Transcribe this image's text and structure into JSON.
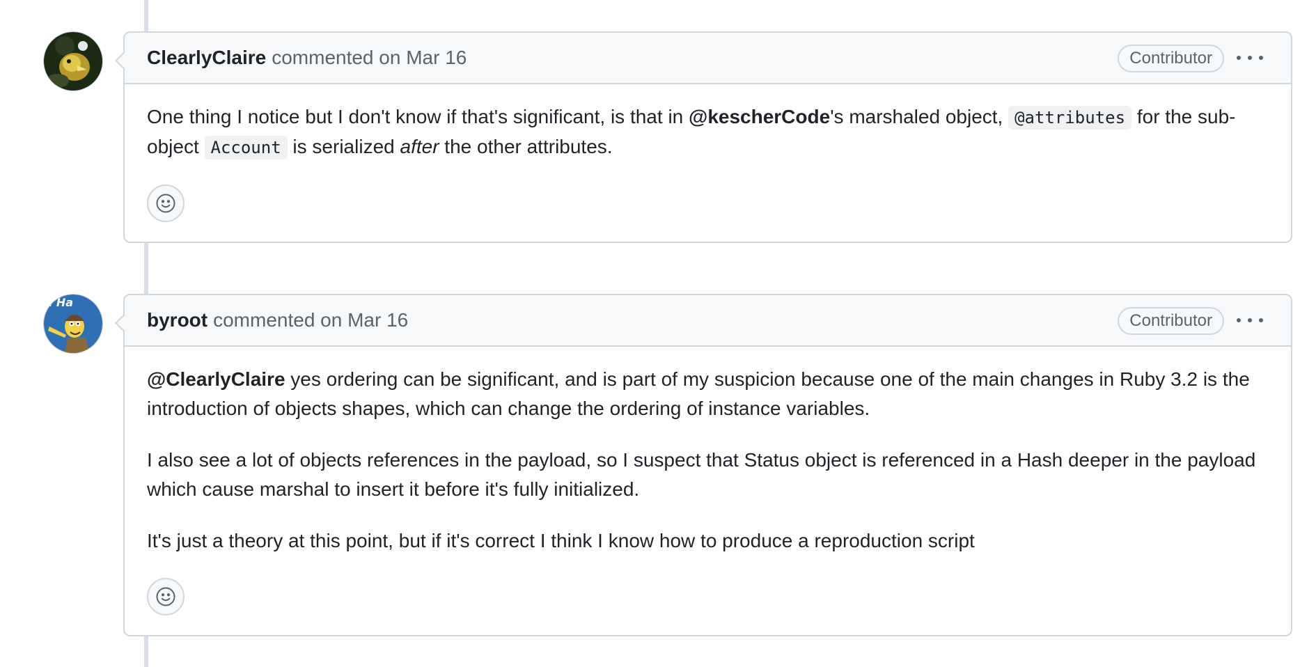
{
  "comments": [
    {
      "author": "ClearlyClaire",
      "action": "commented on",
      "date": "Mar 16",
      "role_badge": "Contributor",
      "paragraphs": [
        {
          "t1": "One thing I notice but I don't know if that's significant, is that in ",
          "mention": "@kescherCode",
          "t2": "'s marshaled object, ",
          "code1": "@attributes",
          "t3": " for the sub-object ",
          "code2": "Account",
          "t4": " is serialized ",
          "em": "after",
          "t5": " the other attributes."
        }
      ]
    },
    {
      "author": "byroot",
      "action": "commented on",
      "date": "Mar 16",
      "role_badge": "Contributor",
      "paragraphs": [
        {
          "mention": "@ClearlyClaire",
          "text": " yes ordering can be significant, and is part of my suspicion because one of the main changes in Ruby 3.2 is the introduction of objects shapes, which can change the ordering of instance variables."
        },
        {
          "text": "I also see a lot of objects references in the payload, so I suspect that Status object is referenced in a Hash deeper in the payload which cause marshal to insert it before it's fully initialized."
        },
        {
          "text": "It's just a theory at this point, but if it's correct I think I know how to produce a reproduction script"
        }
      ]
    }
  ],
  "icons": {
    "reaction": "smiley-icon",
    "menu": "kebab-horizontal-icon"
  },
  "colors": {
    "border": "#d0d7de",
    "header_bg": "#f6f8fa",
    "muted_text": "#59636e",
    "text": "#1f2328"
  }
}
